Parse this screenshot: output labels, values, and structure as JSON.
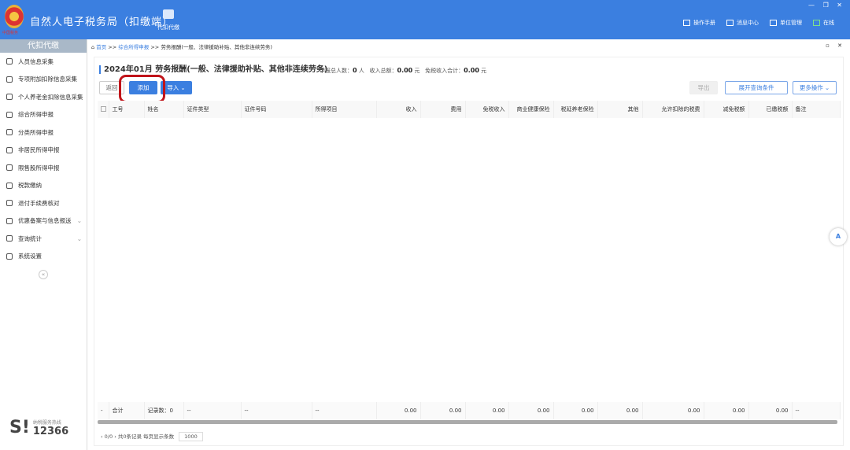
{
  "app": {
    "title": "自然人电子税务局（扣缴端）",
    "emblem_text": "中国税务",
    "tab": "代扣代缴",
    "win_controls": "— ❐ ✕"
  },
  "topnav": [
    {
      "label": "操作手册",
      "icon": "manual-icon"
    },
    {
      "label": "消息中心",
      "icon": "message-icon"
    },
    {
      "label": "单位管理",
      "icon": "unit-icon"
    },
    {
      "label": "在线",
      "icon": "online-icon"
    }
  ],
  "sidebar": {
    "header": "代扣代缴",
    "items": [
      {
        "label": "人员信息采集",
        "icon": "person-icon"
      },
      {
        "label": "专项附加扣除信息采集",
        "icon": "list-icon"
      },
      {
        "label": "个人养老金扣除信息采集",
        "icon": "pension-icon"
      },
      {
        "label": "综合所得申报",
        "icon": "layers-icon"
      },
      {
        "label": "分类所得申报",
        "icon": "pie-icon"
      },
      {
        "label": "非居民所得申报",
        "icon": "user-icon"
      },
      {
        "label": "限售股所得申报",
        "icon": "chart-icon"
      },
      {
        "label": "税款缴纳",
        "icon": "folder-icon"
      },
      {
        "label": "退付手续费核对",
        "icon": "check-doc-icon"
      },
      {
        "label": "优惠备案与信息报送",
        "icon": "doc-icon",
        "chevron": "⌄"
      },
      {
        "label": "查询统计",
        "icon": "query-icon",
        "chevron": "⌄"
      },
      {
        "label": "系统设置",
        "icon": "gear-icon"
      }
    ],
    "collapse": "«",
    "hotline_label": "纳税服务热线",
    "hotline_number": "12366"
  },
  "breadcrumb": {
    "home": "首页",
    "sep": ">>",
    "level2": "综合所得申报",
    "current": "劳务报酬(一般、法律援助补贴、其他非连续劳务)",
    "controls": "▫ ✕"
  },
  "panel": {
    "title": "2024年01月 劳务报酬(一般、法律援助补贴、其他非连续劳务)",
    "stats": {
      "people_label": "申报总人数：",
      "people": "0",
      "people_unit": "人",
      "income_label": "收入总额：",
      "income": "0.00",
      "income_unit": "元",
      "free_label": "免税收入合计：",
      "free": "0.00",
      "free_unit": "元"
    },
    "buttons": {
      "back": "返回",
      "add": "添加",
      "import": "导入 ⌄",
      "export": "导出",
      "query": "展开查询条件",
      "more": "更多操作 ⌄"
    }
  },
  "table": {
    "columns": [
      "工号",
      "姓名",
      "证件类型",
      "证件号码",
      "所得项目",
      "收入",
      "费用",
      "免税收入",
      "商业健康保险",
      "税延养老保险",
      "其他",
      "允许扣除的税费",
      "减免税额",
      "已缴税额",
      "备注"
    ],
    "footer": [
      "-",
      "合计",
      "记录数：0",
      "--",
      "--",
      "--",
      "0.00",
      "0.00",
      "0.00",
      "0.00",
      "0.00",
      "0.00",
      "0.00",
      "0.00",
      "0.00",
      "--"
    ]
  },
  "pager": {
    "nav": "‹ 0/0 ›",
    "total": "共0条记录",
    "per_page_label": "每页显示条数",
    "per_page": "1000"
  },
  "float_icon": "A"
}
